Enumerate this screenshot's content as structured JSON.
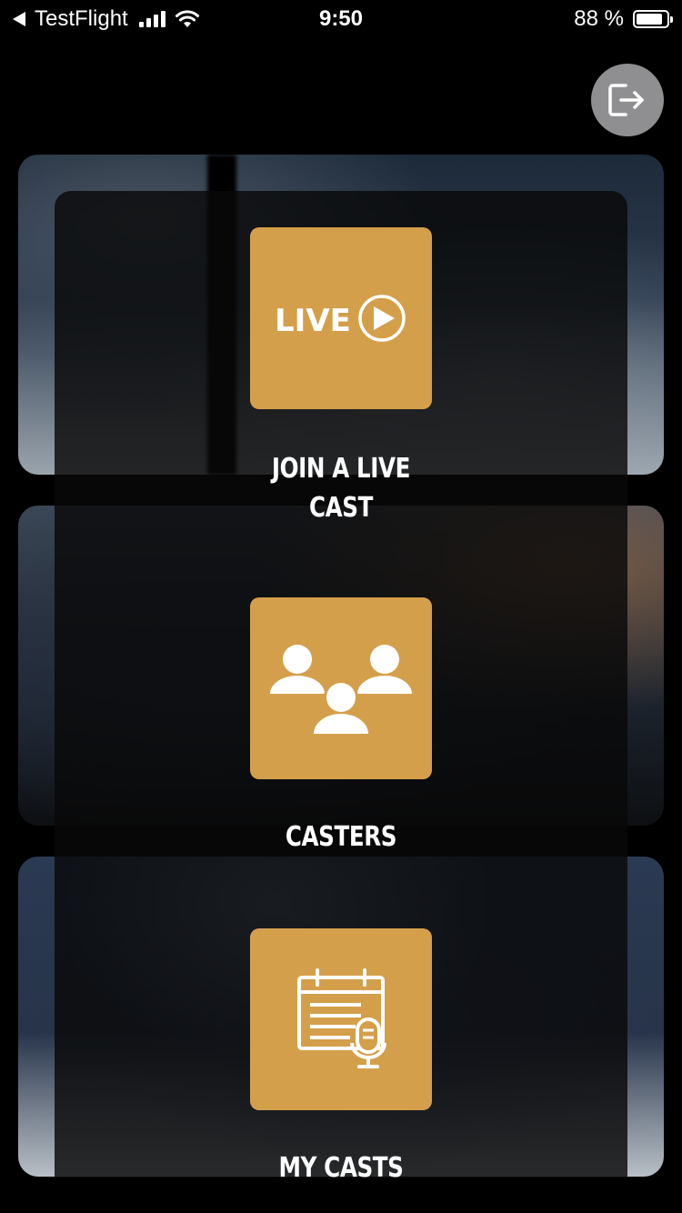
{
  "status_bar": {
    "back_app": "TestFlight",
    "time": "9:50",
    "battery_percent": "88 %",
    "battery_level": 0.88
  },
  "header": {
    "logout_icon": "logout-icon"
  },
  "menu": {
    "items": [
      {
        "label": "JOIN A LIVE CAST",
        "icon": "live-play-icon",
        "icon_text": "LIVE"
      },
      {
        "label": "CASTERS",
        "icon": "group-users-icon"
      },
      {
        "label": "MY CASTS",
        "icon": "calendar-microphone-icon"
      }
    ]
  },
  "colors": {
    "accent": "#d49f4b",
    "logout_bg": "#8f8f91",
    "background": "#000000"
  }
}
